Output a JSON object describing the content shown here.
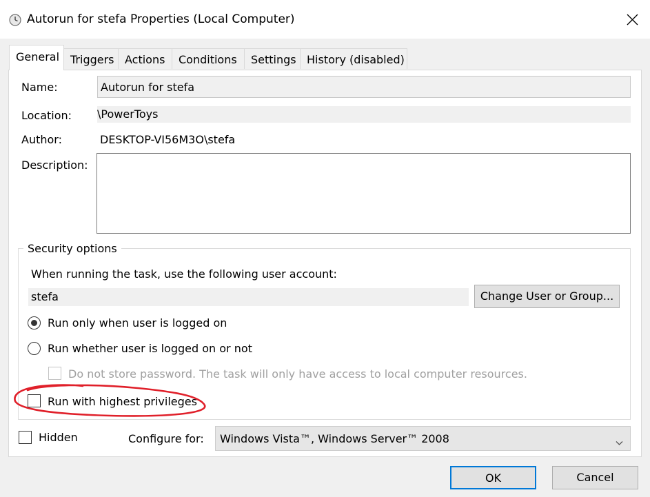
{
  "window": {
    "title": "Autorun for stefa Properties (Local Computer)",
    "icon": "clock-icon",
    "close_icon": "close-icon"
  },
  "tabs": [
    {
      "label": "General",
      "active": true
    },
    {
      "label": "Triggers",
      "active": false
    },
    {
      "label": "Actions",
      "active": false
    },
    {
      "label": "Conditions",
      "active": false
    },
    {
      "label": "Settings",
      "active": false
    },
    {
      "label": "History (disabled)",
      "active": false
    }
  ],
  "general": {
    "name_label": "Name:",
    "name_value": "Autorun for stefa",
    "location_label": "Location:",
    "location_value": "\\PowerToys",
    "author_label": "Author:",
    "author_value": "DESKTOP-VI56M3O\\stefa",
    "description_label": "Description:",
    "description_value": ""
  },
  "security": {
    "title": "Security options",
    "account_prompt": "When running the task, use the following user account:",
    "account_value": "stefa",
    "change_button": "Change User or Group...",
    "radio_logged_on": "Run only when user is logged on",
    "radio_logged_on_selected": true,
    "radio_whether": "Run whether user is logged on or not",
    "radio_whether_selected": false,
    "no_store_password": "Do not store password.  The task will only have access to local computer resources.",
    "no_store_password_checked": false,
    "highest_privileges": "Run with highest privileges",
    "highest_privileges_checked": false
  },
  "footer": {
    "hidden_label": "Hidden",
    "hidden_checked": false,
    "configure_label": "Configure for:",
    "configure_value": "Windows Vista™, Windows Server™ 2008"
  },
  "buttons": {
    "ok": "OK",
    "cancel": "Cancel"
  },
  "colors": {
    "annotation": "#e0202a",
    "default_button_border": "#0078d7",
    "window_bg": "#f0f0f0"
  }
}
